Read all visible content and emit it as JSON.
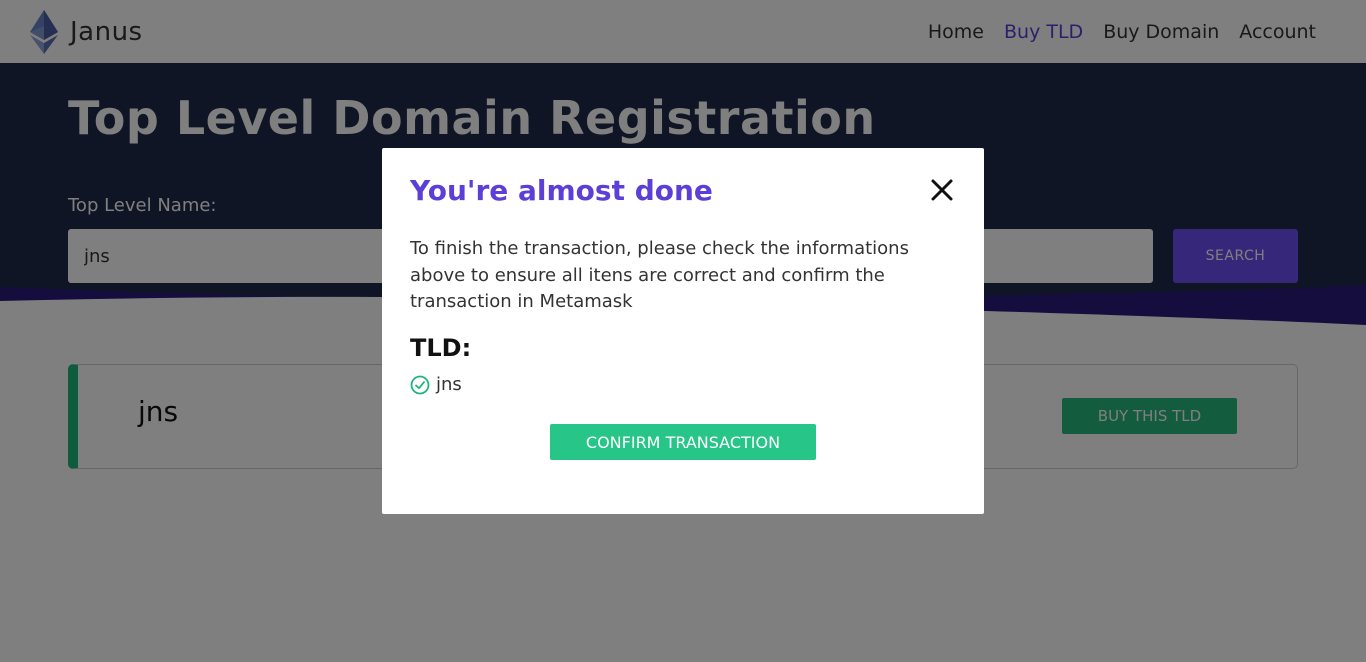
{
  "navbar": {
    "brand": "Janus",
    "links": [
      {
        "label": "Home",
        "active": false
      },
      {
        "label": "Buy TLD",
        "active": true
      },
      {
        "label": "Buy Domain",
        "active": false
      },
      {
        "label": "Account",
        "active": false
      }
    ]
  },
  "hero": {
    "title": "Top Level Domain Registration",
    "field_label": "Top Level Name:",
    "search_value": "jns",
    "search_button": "SEARCH"
  },
  "result": {
    "name": "jns",
    "buy_button": "BUY THIS TLD"
  },
  "modal": {
    "title": "You're almost done",
    "text": "To finish the transaction, please check the informations above to ensure all itens are correct and confirm the transaction in Metamask",
    "tld_heading": "TLD:",
    "tld_item": "jns",
    "confirm_button": "CONFIRM TRANSACTION"
  },
  "colors": {
    "accent_purple": "#5b3fd6",
    "hero_navy": "#1f2a4a",
    "success_green": "#27c688",
    "search_button": "#6c4ff4"
  },
  "icons": {
    "logo": "ethereum-logo-icon",
    "close": "close-icon",
    "check": "check-circle-icon"
  }
}
